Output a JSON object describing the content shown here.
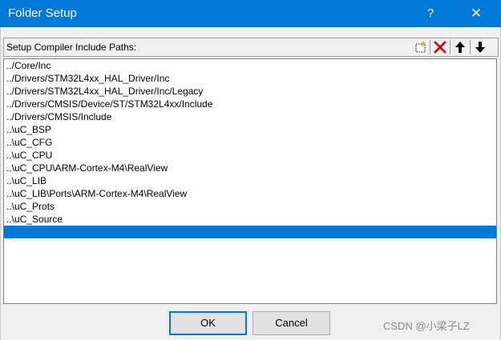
{
  "window": {
    "title": "Folder Setup",
    "help_glyph": "?",
    "close_glyph": "✕"
  },
  "panel": {
    "label": "Setup Compiler Include Paths:",
    "toolbar": {
      "new_icon": "new-folder-icon",
      "delete_icon": "delete-x-icon",
      "move_up_icon": "arrow-up-icon",
      "move_down_icon": "arrow-down-icon"
    }
  },
  "paths": [
    "../Core/Inc",
    "../Drivers/STM32L4xx_HAL_Driver/Inc",
    "../Drivers/STM32L4xx_HAL_Driver/Inc/Legacy",
    "../Drivers/CMSIS/Device/ST/STM32L4xx/Include",
    "../Drivers/CMSIS/Include",
    "..\\uC_BSP",
    "..\\uC_CFG",
    "..\\uC_CPU",
    "..\\uC_CPU\\ARM-Cortex-M4\\RealView",
    "..\\uC_LIB",
    "..\\uC_LIB\\Ports\\ARM-Cortex-M4\\RealView",
    "..\\uC_Prots",
    "..\\uC_Source",
    ""
  ],
  "selected_index": 13,
  "buttons": {
    "ok": "OK",
    "cancel": "Cancel"
  },
  "watermark": "CSDN @小梁子LZ",
  "colors": {
    "accent": "#0078d7",
    "delete": "#c00000"
  }
}
